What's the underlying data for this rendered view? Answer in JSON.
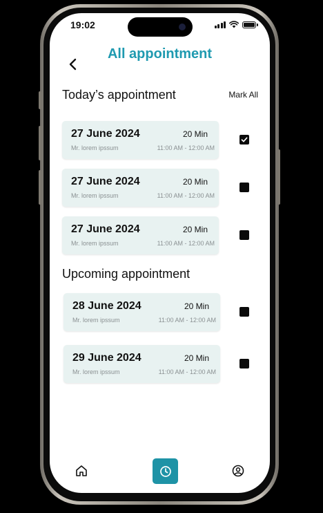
{
  "status": {
    "time": "19:02"
  },
  "header": {
    "title": "All appointment"
  },
  "today": {
    "title": "Today’s appointment",
    "mark_all": "Mark All",
    "items": [
      {
        "date": "27 June 2024",
        "duration": "20 Min",
        "name": "Mr. lorem ipssum",
        "time": "11:00 AM - 12:00 AM",
        "checked": true
      },
      {
        "date": "27 June 2024",
        "duration": "20 Min",
        "name": "Mr. lorem ipssum",
        "time": "11:00 AM - 12:00 AM",
        "checked": false
      },
      {
        "date": "27 June 2024",
        "duration": "20 Min",
        "name": "Mr. lorem ipssum",
        "time": "11:00 AM - 12:00 AM",
        "checked": false
      }
    ]
  },
  "upcoming": {
    "title": "Upcoming appointment",
    "items": [
      {
        "date": "28 June 2024",
        "duration": "20 Min",
        "name": "Mr. lorem ipssum",
        "time": "11:00 AM - 12:00 AM",
        "checked": false
      },
      {
        "date": "29 June 2024",
        "duration": "20 Min",
        "name": "Mr. lorem ipssum",
        "time": "11:00 AM - 12:00 AM",
        "checked": false
      }
    ]
  },
  "nav": {
    "items": [
      {
        "icon": "home-icon",
        "active": false
      },
      {
        "icon": "clock-icon",
        "active": true
      },
      {
        "icon": "profile-icon",
        "active": false
      }
    ]
  },
  "colors": {
    "accent": "#1f9ab0",
    "card_bg": "#e8f2f1",
    "nav_active": "#1e93a6"
  }
}
